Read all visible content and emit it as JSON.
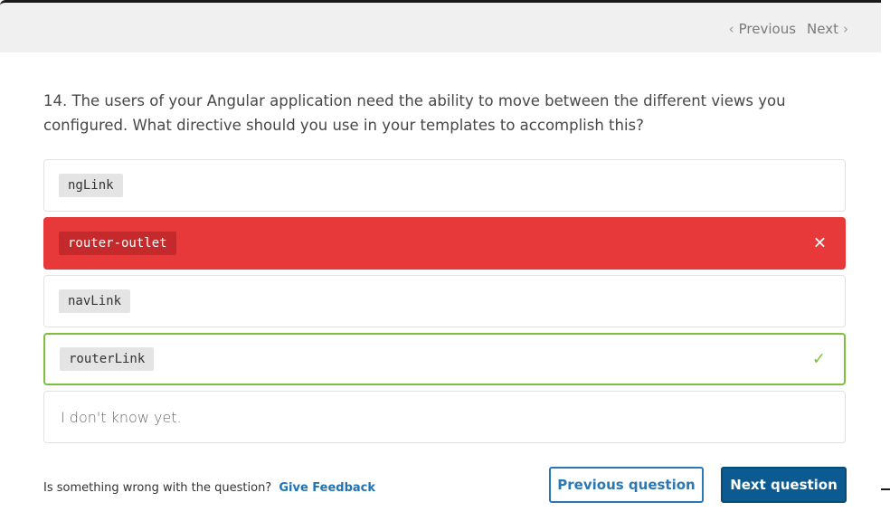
{
  "nav": {
    "previous_label": "Previous",
    "next_label": "Next"
  },
  "question": {
    "text": "14. The users of your Angular application need the ability to move between the different views you configured. What directive should you use in your templates to accomplish this?"
  },
  "options": [
    {
      "label": "ngLink",
      "state": "neutral"
    },
    {
      "label": "router-outlet",
      "state": "wrong",
      "mark": "✕"
    },
    {
      "label": "navLink",
      "state": "neutral"
    },
    {
      "label": "routerLink",
      "state": "correct",
      "mark": "✓"
    },
    {
      "label": "I don't know yet.",
      "state": "neutral"
    }
  ],
  "footer": {
    "feedback_prompt": "Is something wrong with the question?",
    "feedback_link": "Give Feedback",
    "prev_button": "Previous question",
    "next_button": "Next question"
  },
  "colors": {
    "wrong": "#e8393a",
    "correct": "#7cc03c",
    "primary": "#0b5a91",
    "link": "#1f74b8"
  }
}
